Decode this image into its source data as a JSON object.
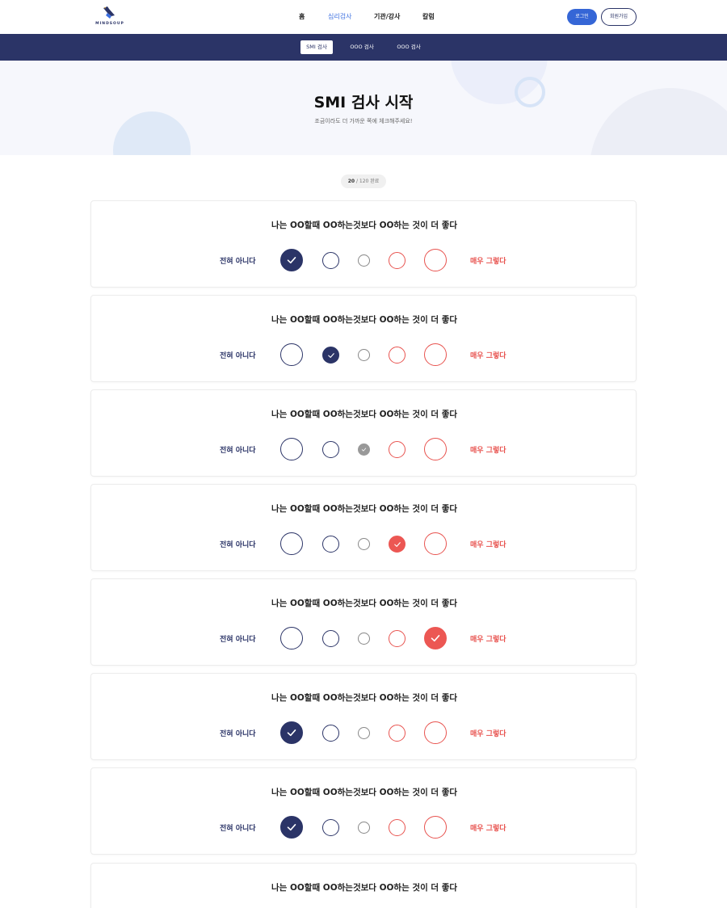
{
  "header": {
    "logo_text": "MINDSOUP",
    "nav": [
      {
        "label": "홈",
        "active": false
      },
      {
        "label": "심리검사",
        "active": true
      },
      {
        "label": "기관/강사",
        "active": false
      },
      {
        "label": "칼럼",
        "active": false
      }
    ],
    "login_label": "로그인",
    "join_label": "회원가입"
  },
  "subnav": [
    {
      "label": "SMI 검사",
      "active": true
    },
    {
      "label": "OOO 검사",
      "active": false
    },
    {
      "label": "OOO 검사",
      "active": false
    }
  ],
  "hero": {
    "title": "SMI 검사 시작",
    "subtitle": "조금이라도 더 가까운 쪽에 체크해주세요!"
  },
  "progress": {
    "current": "20",
    "rest": " / 120 완료"
  },
  "scale": {
    "left_label": "전혀 아니다",
    "right_label": "매우 그렇다"
  },
  "questions": [
    {
      "text": "나는 OO할때 OO하는것보다 OO하는 것이 더 좋다",
      "selected": 1
    },
    {
      "text": "나는 OO할때 OO하는것보다 OO하는 것이 더 좋다",
      "selected": 2
    },
    {
      "text": "나는 OO할때 OO하는것보다 OO하는 것이 더 좋다",
      "selected": 3
    },
    {
      "text": "나는 OO할때 OO하는것보다 OO하는 것이 더 좋다",
      "selected": 4
    },
    {
      "text": "나는 OO할때 OO하는것보다 OO하는 것이 더 좋다",
      "selected": 5
    },
    {
      "text": "나는 OO할때 OO하는것보다 OO하는 것이 더 좋다",
      "selected": 1
    },
    {
      "text": "나는 OO할때 OO하는것보다 OO하는 것이 더 좋다",
      "selected": 1
    },
    {
      "text": "나는 OO할때 OO하는것보다 OO하는 것이 더 좋다",
      "selected": 0
    }
  ],
  "colors": {
    "navy": "#2b3467",
    "accent_blue": "#3566d6",
    "red": "#e8534f",
    "gray": "#999999"
  },
  "icons": {
    "option_selected": "check-icon"
  }
}
